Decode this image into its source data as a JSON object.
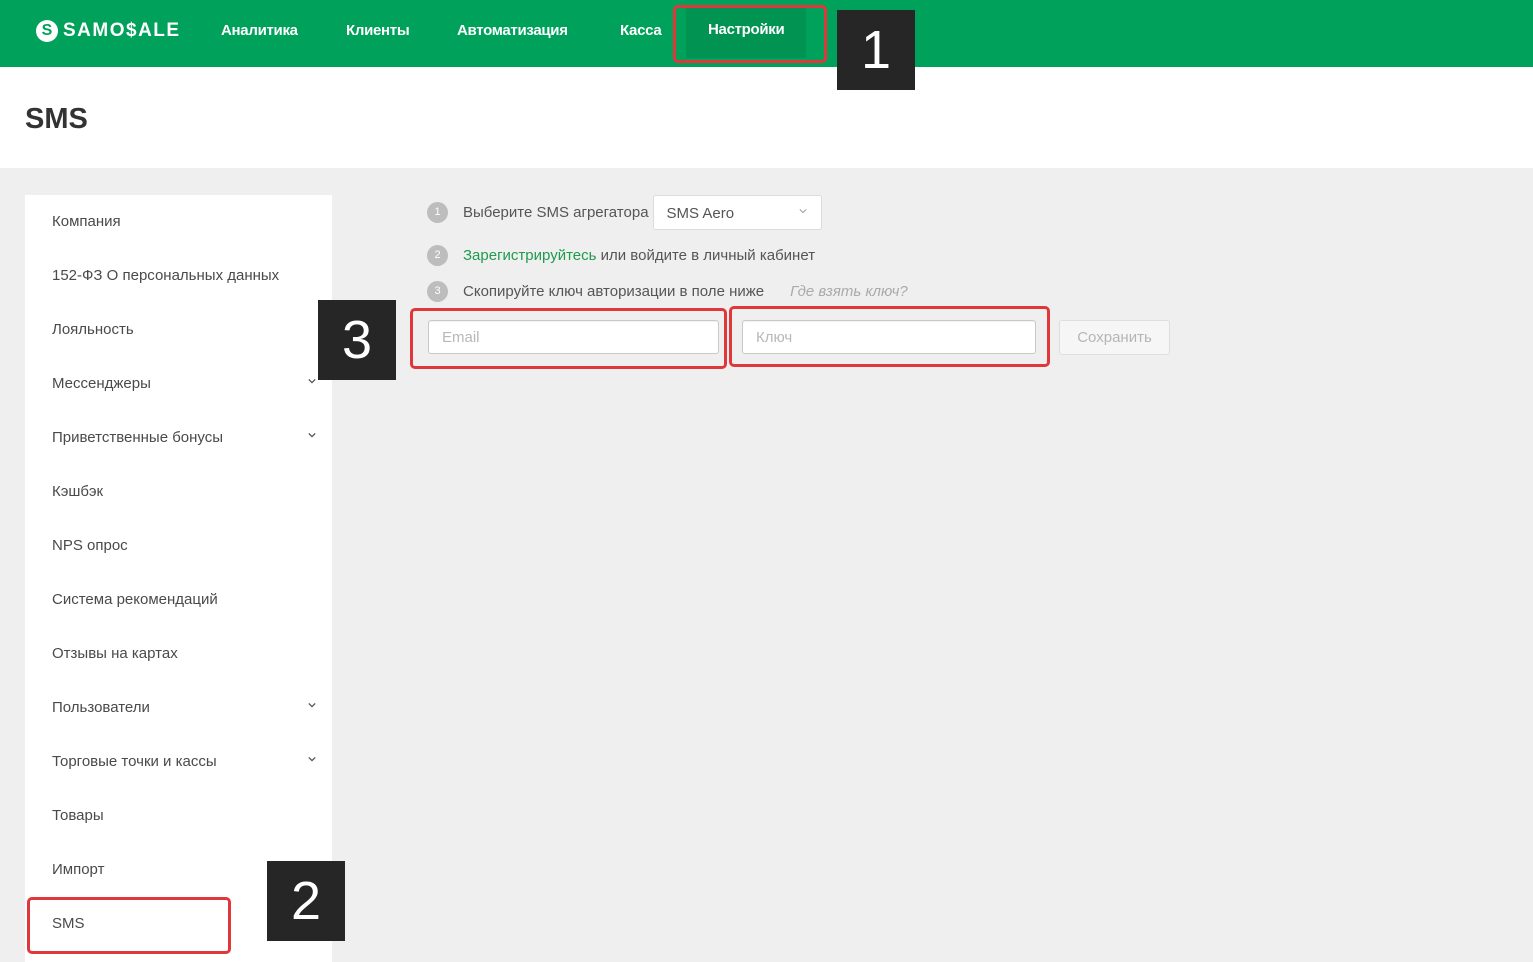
{
  "brand": {
    "logo_mark": "S",
    "logo_text": "SAMO$ALE"
  },
  "nav": {
    "items": [
      {
        "label": "Аналитика"
      },
      {
        "label": "Клиенты"
      },
      {
        "label": "Автоматизация"
      },
      {
        "label": "Касса"
      },
      {
        "label": "Настройки",
        "active": true
      }
    ]
  },
  "page": {
    "title": "SMS"
  },
  "sidebar": {
    "items": [
      {
        "label": "Компания"
      },
      {
        "label": "152-ФЗ О персональных данных"
      },
      {
        "label": "Лояльность"
      },
      {
        "label": "Мессенджеры",
        "expandable": true
      },
      {
        "label": "Приветственные бонусы",
        "expandable": true
      },
      {
        "label": "Кэшбэк"
      },
      {
        "label": "NPS опрос"
      },
      {
        "label": "Система рекомендаций"
      },
      {
        "label": "Отзывы на картах"
      },
      {
        "label": "Пользователи",
        "expandable": true
      },
      {
        "label": "Торговые точки и кассы",
        "expandable": true
      },
      {
        "label": "Товары"
      },
      {
        "label": "Импорт"
      },
      {
        "label": "SMS",
        "active": true
      }
    ]
  },
  "steps": {
    "s1": {
      "num": "1",
      "text": "Выберите SMS агрегатора",
      "select_value": "SMS Aero"
    },
    "s2": {
      "num": "2",
      "link": "Зарегистрируйтесь",
      "text": " или войдите в личный кабинет"
    },
    "s3": {
      "num": "3",
      "text": "Скопируйте ключ авторизации в поле ниже",
      "hint": "Где взять ключ?"
    }
  },
  "form": {
    "email_placeholder": "Email",
    "email_value": "",
    "key_placeholder": "Ключ",
    "key_value": "",
    "save_label": "Сохранить"
  },
  "annotations": {
    "a1": "1",
    "a2": "2",
    "a3": "3"
  },
  "colors": {
    "brand_green": "#00a15a",
    "highlight_red": "#e0383a",
    "badge_bg": "#262626"
  }
}
